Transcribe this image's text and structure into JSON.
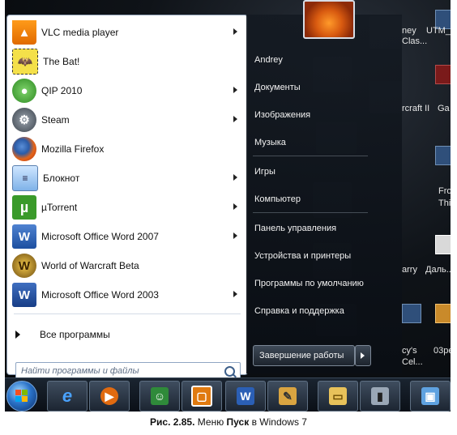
{
  "programs": [
    {
      "label": "VLC media player",
      "icon": "vlc-icon",
      "has_submenu": true
    },
    {
      "label": "The Bat!",
      "icon": "the-bat-icon",
      "has_submenu": false
    },
    {
      "label": "QIP 2010",
      "icon": "qip-icon",
      "has_submenu": true
    },
    {
      "label": "Steam",
      "icon": "steam-icon",
      "has_submenu": true
    },
    {
      "label": "Mozilla Firefox",
      "icon": "firefox-icon",
      "has_submenu": false
    },
    {
      "label": "Блокнот",
      "icon": "notepad-icon",
      "has_submenu": true
    },
    {
      "label": "µTorrent",
      "icon": "utorrent-icon",
      "has_submenu": true
    },
    {
      "label": "Microsoft Office Word 2007",
      "icon": "word-2007-icon",
      "has_submenu": true
    },
    {
      "label": "World of Warcraft Beta",
      "icon": "wow-icon",
      "has_submenu": false
    },
    {
      "label": "Microsoft Office Word 2003",
      "icon": "word-2003-icon",
      "has_submenu": true
    }
  ],
  "all_programs": "Все программы",
  "search": {
    "placeholder": "Найти программы и файлы"
  },
  "places": [
    "Andrey",
    "Документы",
    "Изображения",
    "Музыка",
    "Игры",
    "Компьютер",
    "Панель управления",
    "Устройства и принтеры",
    "Программы по умолчанию",
    "Справка и поддержка"
  ],
  "shutdown": {
    "label": "Завершение работы"
  },
  "desktop_labels": {
    "a": "ney",
    "b": "Clas...",
    "c": "UTM_",
    "d": "rcraft II",
    "e": "Ga",
    "f": "Fro",
    "g": "Thi",
    "h": "arry",
    "i": "Даль...",
    "j": "cy's",
    "k": "Cel...",
    "l": "03pe"
  },
  "taskbar": [
    "ie-icon",
    "media-player-icon",
    "messenger-icon",
    "vmware-icon",
    "word-icon",
    "paint-icon",
    "explorer-icon",
    "computer-icon",
    "screen-icon"
  ],
  "caption": {
    "prefix": "Рис. 2.85.",
    "middle": " Меню ",
    "bold": "Пуск",
    "suffix": " в Windows 7"
  }
}
